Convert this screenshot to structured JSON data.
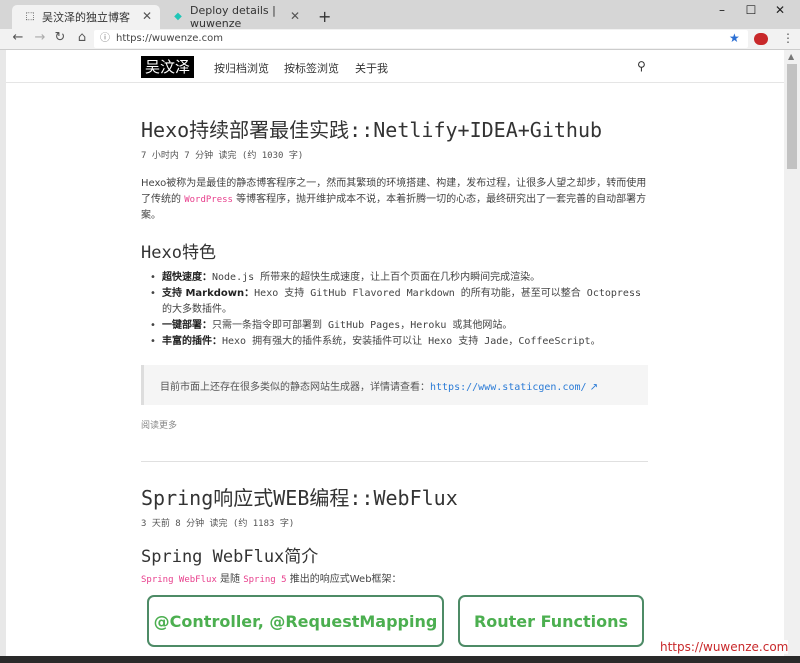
{
  "tabs": [
    {
      "title": "吴汶泽的独立博客",
      "active": true
    },
    {
      "title": "Deploy details | wuwenze",
      "active": false
    }
  ],
  "window_controls": {
    "minimize": "–",
    "maximize": "☐",
    "close": "✕"
  },
  "address_bar": {
    "url": "https://wuwenze.com"
  },
  "site": {
    "brand": "吴汶泽",
    "nav": [
      "按归档浏览",
      "按标签浏览",
      "关于我"
    ]
  },
  "posts": [
    {
      "title": "Hexo持续部署最佳实践::Netlify+IDEA+Github",
      "meta": "7 小时内 7 分钟 读完 (约 1030 字)",
      "intro_before": "Hexo被称为是最佳的静态博客程序之一，然而其繁琐的环境搭建、构建，发布过程，让很多人望之却步，转而使用了传统的 ",
      "intro_code": "WordPress",
      "intro_after": " 等博客程序，抛开维护成本不说，本着折腾一切的心态，最终研究出了一套完善的自动部署方案。",
      "section": "Hexo特色",
      "features": [
        {
          "label": "超快速度：",
          "text": "Node.js 所带来的超快生成速度，让上百个页面在几秒内瞬间完成渲染。"
        },
        {
          "label": "支持 Markdown：",
          "text": "Hexo 支持 GitHub Flavored Markdown 的所有功能，甚至可以整合 Octopress 的大多数插件。"
        },
        {
          "label": "一键部署：",
          "text": "只需一条指令即可部署到 GitHub Pages，Heroku 或其他网站。"
        },
        {
          "label": "丰富的插件：",
          "text": "Hexo 拥有强大的插件系统，安装插件可以让 Hexo 支持 Jade，CoffeeScript。"
        }
      ],
      "note_text": "目前市面上还存在很多类似的静态网站生成器，详情请查看：",
      "note_link": "https://www.staticgen.com/",
      "read_more": "阅读更多"
    },
    {
      "title": "Spring响应式WEB编程::WebFlux",
      "meta": "3 天前 8 分钟 读完 (约 1183 字)",
      "section": "Spring WebFlux简介",
      "intro_code1": "Spring WebFlux",
      "intro_mid": " 是随 ",
      "intro_code2": "Spring 5",
      "intro_after": " 推出的响应式Web框架：",
      "boxes": [
        "@Controller, @RequestMapping",
        "Router Functions"
      ]
    }
  ],
  "watermark": "https://wuwenze.com"
}
